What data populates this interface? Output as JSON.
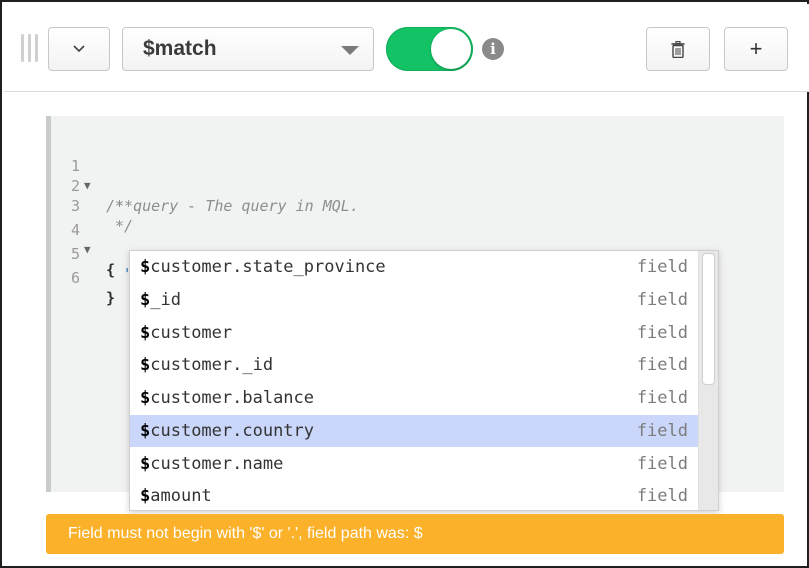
{
  "toolbar": {
    "stage_operator": "$match",
    "collapse_glyph": "chevron-down",
    "toggle_enabled": true,
    "info_glyph": "i",
    "add_label": "+"
  },
  "editor": {
    "lines": [
      {
        "number": "1",
        "foldable": true,
        "text": "/**"
      },
      {
        "number": "2",
        "foldable": false,
        "text": " * query - The query in MQL."
      },
      {
        "number": "3",
        "foldable": false,
        "text": " */"
      },
      {
        "number": "4",
        "foldable": true,
        "text": "{"
      },
      {
        "number": "5",
        "foldable": false,
        "text": "  \"$\""
      },
      {
        "number": "6",
        "foldable": false,
        "text": "}"
      }
    ]
  },
  "autocomplete": {
    "items": [
      {
        "prefix": "$",
        "rest": "customer.state_province",
        "meta": "field",
        "selected": false
      },
      {
        "prefix": "$",
        "rest": "_id",
        "meta": "field",
        "selected": false
      },
      {
        "prefix": "$",
        "rest": "customer",
        "meta": "field",
        "selected": false
      },
      {
        "prefix": "$",
        "rest": "customer._id",
        "meta": "field",
        "selected": false
      },
      {
        "prefix": "$",
        "rest": "customer.balance",
        "meta": "field",
        "selected": false
      },
      {
        "prefix": "$",
        "rest": "customer.country",
        "meta": "field",
        "selected": true
      },
      {
        "prefix": "$",
        "rest": "customer.name",
        "meta": "field",
        "selected": false
      },
      {
        "prefix": "$",
        "rest": "amount",
        "meta": "field",
        "selected": false
      }
    ]
  },
  "error": {
    "message": "Field must not begin with '$' or '.', field path was: $"
  },
  "colors": {
    "toggle_on": "#13c265",
    "selected_row": "#cad6fa",
    "warning": "#fbb129"
  }
}
